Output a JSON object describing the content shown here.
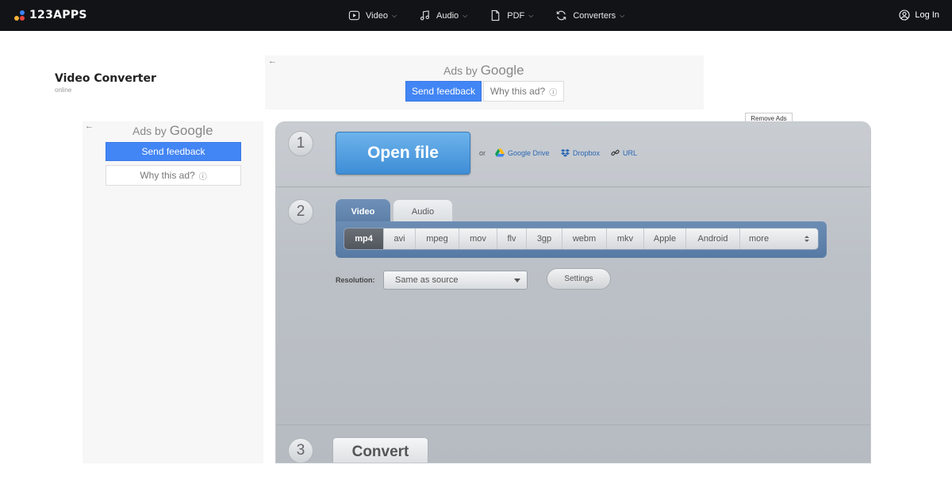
{
  "brand": {
    "logo_text": "123APPS",
    "dot_colors": [
      "#f6b23a",
      "#e8453c",
      "#3b82f6"
    ]
  },
  "nav": {
    "items": [
      {
        "label": "Video",
        "icon": "play-icon"
      },
      {
        "label": "Audio",
        "icon": "music-note-icon"
      },
      {
        "label": "PDF",
        "icon": "document-icon"
      },
      {
        "label": "Converters",
        "icon": "refresh-icon"
      }
    ],
    "chevron": "⌵",
    "login_label": "Log In"
  },
  "page": {
    "title": "Video Converter",
    "subtitle": "online"
  },
  "ads": {
    "top": {
      "ads_by": "Ads by",
      "google": "Google",
      "feedback_label": "Send feedback",
      "why_label": "Why this ad?"
    },
    "side": {
      "ads_by": "Ads by",
      "google": "Google",
      "feedback_label": "Send feedback",
      "why_label": "Why this ad?"
    },
    "remove_ads_label": "Remove Ads"
  },
  "converter": {
    "steps": [
      "1",
      "2",
      "3"
    ],
    "open_file_label": "Open file",
    "or_label": "or",
    "sources": [
      {
        "label": "Google Drive",
        "icon": "google-drive-icon"
      },
      {
        "label": "Dropbox",
        "icon": "dropbox-icon"
      },
      {
        "label": "URL",
        "icon": "link-icon"
      }
    ],
    "tabs": [
      {
        "label": "Video",
        "active": true
      },
      {
        "label": "Audio",
        "active": false
      }
    ],
    "formats": [
      "mp4",
      "avi",
      "mpeg",
      "mov",
      "flv",
      "3gp",
      "webm",
      "mkv",
      "Apple",
      "Android"
    ],
    "selected_format": "mp4",
    "more_label": "more",
    "resolution_label": "Resolution:",
    "resolution_value": "Same as source",
    "settings_label": "Settings",
    "convert_label": "Convert"
  },
  "colors": {
    "accent": "#4285f4",
    "open_button": "#4a97dc",
    "link": "#2b67b3",
    "topbar": "#111317"
  }
}
